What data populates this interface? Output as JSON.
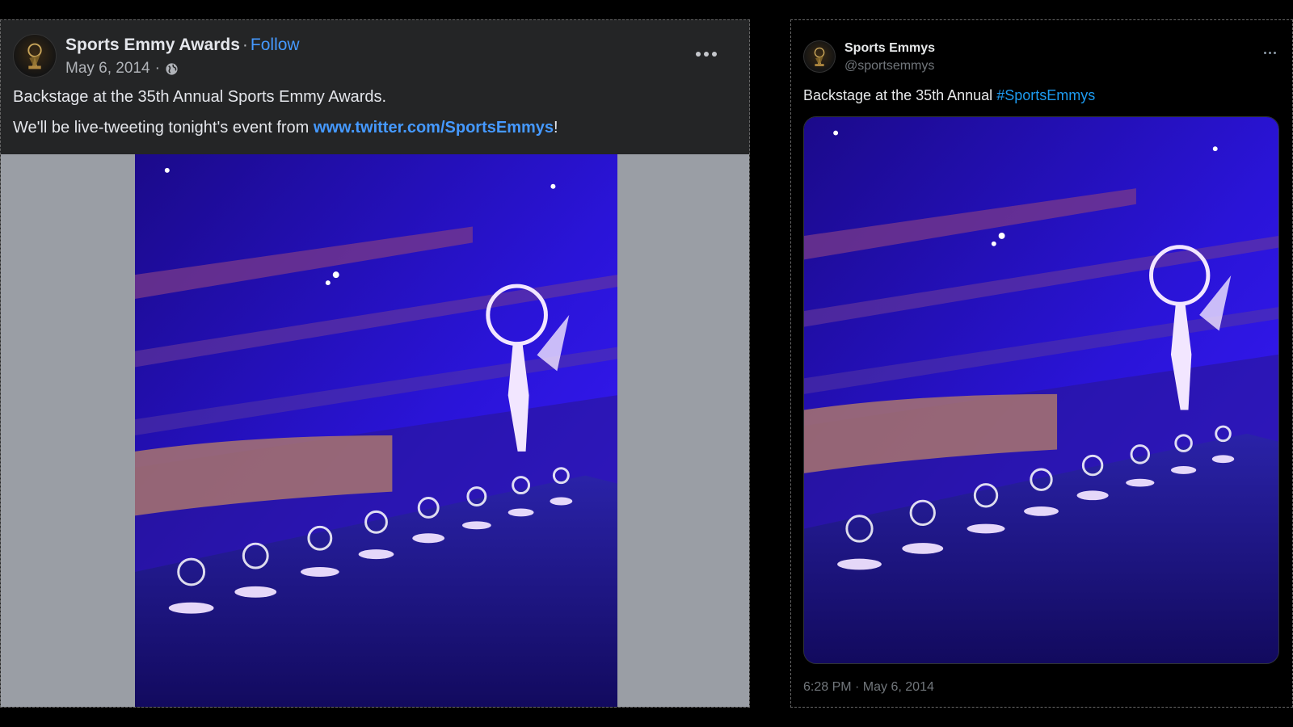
{
  "facebook_post": {
    "author": "Sports Emmy Awards",
    "separator": "·",
    "follow_label": "Follow",
    "date": "May 6, 2014",
    "date_separator": "·",
    "privacy_icon": "globe-icon",
    "more_icon": "more-horizontal-icon",
    "text_line1": "Backstage at the 35th Annual Sports Emmy Awards.",
    "text_line2_prefix": "We'll be live-tweeting tonight's event from ",
    "link_text": "www.twitter.com/SportsEmmys",
    "text_line2_suffix": "!",
    "colors": {
      "background": "#242526",
      "link": "#4599ff",
      "media_letterbox": "#9a9ea5"
    }
  },
  "twitter_post": {
    "display_name": "Sports Emmys",
    "handle": "@sportsemmys",
    "more_icon": "more-horizontal-icon",
    "text_prefix": "Backstage at the 35th Annual ",
    "hashtag": "#SportsEmmys",
    "timestamp": "6:28 PM · May 6, 2014",
    "colors": {
      "background": "#000000",
      "hashtag": "#1d9bf0"
    }
  }
}
